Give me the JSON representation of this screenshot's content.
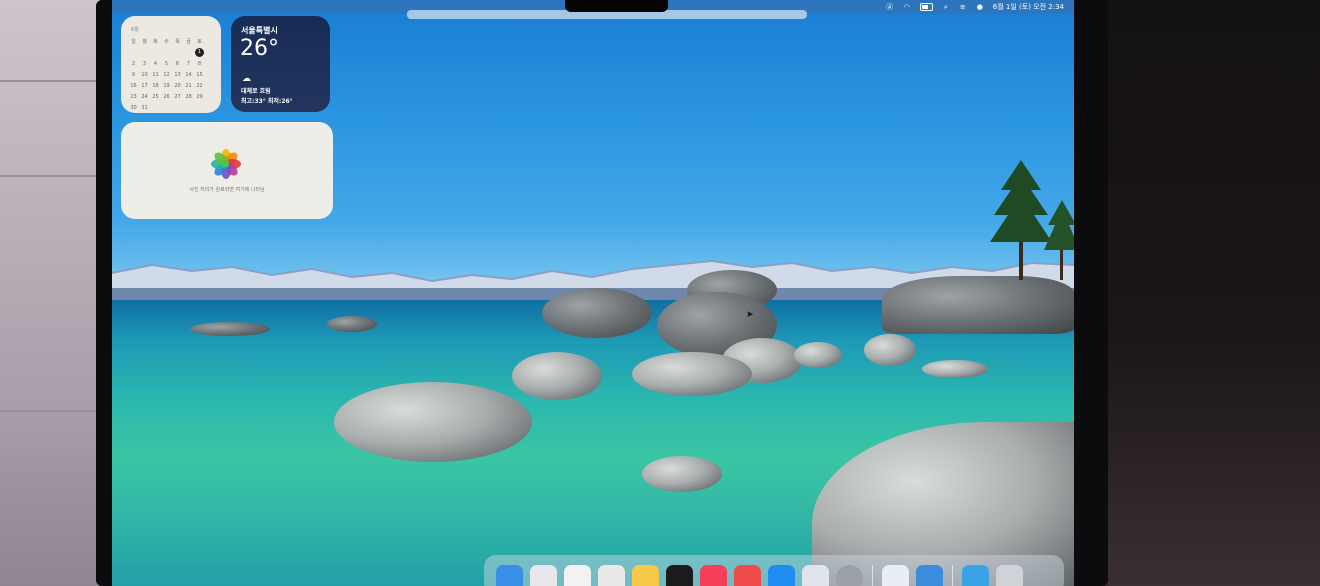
{
  "menubar": {
    "status_time": "6월 1일 (토) 오전 2:34",
    "status_icons": [
      "accessibility-icon",
      "wifi-icon",
      "battery-icon",
      "search-icon",
      "control-center-icon",
      "siri-icon"
    ]
  },
  "calendar_widget": {
    "month": "6월",
    "weekdays": [
      "일",
      "월",
      "화",
      "수",
      "목",
      "금",
      "토"
    ],
    "weeks": [
      [
        "",
        "",
        "",
        "",
        "",
        "",
        "1"
      ],
      [
        "2",
        "3",
        "4",
        "5",
        "6",
        "7",
        "8"
      ],
      [
        "9",
        "10",
        "11",
        "12",
        "13",
        "14",
        "15"
      ],
      [
        "16",
        "17",
        "18",
        "19",
        "20",
        "21",
        "22"
      ],
      [
        "23",
        "24",
        "25",
        "26",
        "27",
        "28",
        "29"
      ],
      [
        "30",
        "31",
        "",
        "",
        "",
        "",
        ""
      ]
    ],
    "today": "1"
  },
  "weather_widget": {
    "city": "서울특별시",
    "temperature": "26°",
    "condition_icon": "cloud-icon",
    "condition": "대체로 흐림",
    "high_low": "최고:33° 최저:26°"
  },
  "photos_widget": {
    "icon": "photos-icon",
    "message": "사진 처리가 완료되면 여기에 나타남"
  },
  "dock": {
    "apps": [
      {
        "name": "finder",
        "color": "#3a8ee6"
      },
      {
        "name": "launchpad",
        "color": "#e8e8ea"
      },
      {
        "name": "safari",
        "color": "#f2f2f2"
      },
      {
        "name": "messages",
        "color": "#e9e9e9"
      },
      {
        "name": "notes",
        "color": "#f7c948"
      },
      {
        "name": "apple-tv",
        "color": "#1c1c1e"
      },
      {
        "name": "music",
        "color": "#f43e5a"
      },
      {
        "name": "news",
        "color": "#f04b4b"
      },
      {
        "name": "app-store",
        "color": "#1e8cf0"
      },
      {
        "name": "preview",
        "color": "#dfe3ea"
      },
      {
        "name": "system-settings",
        "color": "#9aa0a6"
      }
    ],
    "recent": [
      {
        "name": "docs",
        "color": "#e9eef5"
      },
      {
        "name": "weather",
        "color": "#3b8cdb"
      }
    ],
    "trailing": [
      {
        "name": "downloads-folder",
        "color": "#3aa3e8"
      },
      {
        "name": "trash",
        "color": "#cfd3d8"
      }
    ]
  }
}
